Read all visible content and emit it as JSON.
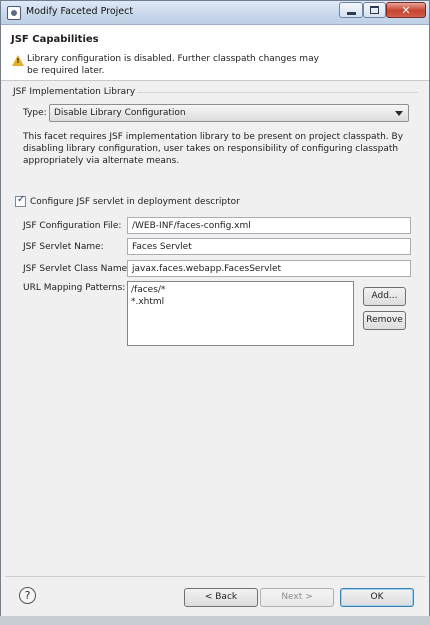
{
  "window": {
    "title": "Modify Faceted Project"
  },
  "header": {
    "title": "JSF Capabilities",
    "message_line1": "Library configuration is disabled. Further classpath changes may",
    "message_line2": "be required later.",
    "warning_icon": "warning-triangle-icon"
  },
  "library": {
    "group_label": "JSF Implementation Library",
    "type_label": "Type:",
    "type_value": "Disable Library Configuration",
    "description_line1": "This facet requires JSF implementation library to be present on project classpath. By",
    "description_line2": "disabling library configuration, user takes on responsibility of configuring classpath",
    "description_line3": "appropriately via alternate means."
  },
  "servlet": {
    "checkbox_label": "Configure JSF servlet in deployment descriptor",
    "checked": true,
    "config_file_label": "JSF Configuration File:",
    "config_file_value": "/WEB-INF/faces-config.xml",
    "servlet_name_label": "JSF Servlet Name:",
    "servlet_name_value": "Faces Servlet",
    "servlet_class_label": "JSF Servlet Class Name:",
    "servlet_class_value": "javax.faces.webapp.FacesServlet",
    "url_mapping_label": "URL Mapping Patterns:",
    "url_patterns": [
      "/faces/*",
      "*.xhtml"
    ],
    "add_label": "Add...",
    "remove_label": "Remove"
  },
  "footer": {
    "help_icon": "help-question-icon",
    "back_label": "< Back",
    "next_label": "Next >",
    "ok_label": "OK"
  }
}
